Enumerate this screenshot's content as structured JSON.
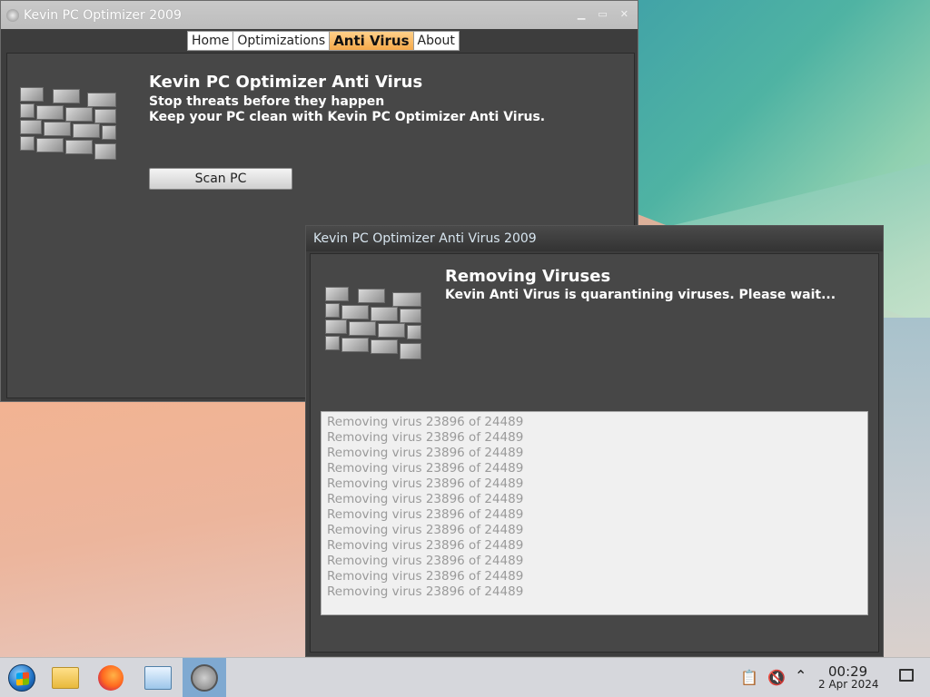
{
  "main_window": {
    "title": "Kevin PC Optimizer 2009",
    "tabs": [
      {
        "label": "Home",
        "active": false
      },
      {
        "label": "Optimizations",
        "active": false
      },
      {
        "label": "Anti Virus",
        "active": true
      },
      {
        "label": "About",
        "active": false
      }
    ],
    "heading": "Kevin PC Optimizer Anti Virus",
    "subheading_1": "Stop threats before they happen",
    "subheading_2": "Keep your PC clean with Kevin PC Optimizer Anti Virus.",
    "scan_button": "Scan PC",
    "icon": "brick-wall-icon"
  },
  "antivirus_window": {
    "title": "Kevin PC Optimizer Anti Virus 2009",
    "heading": "Removing Viruses",
    "subheading": "Kevin Anti Virus is quarantining viruses. Please wait...",
    "icon": "brick-wall-icon",
    "log": [
      "Removing virus 23896 of 24489",
      "Removing virus 23896 of 24489",
      "Removing virus 23896 of 24489",
      "Removing virus 23896 of 24489",
      "Removing virus 23896 of 24489",
      "Removing virus 23896 of 24489",
      "Removing virus 23896 of 24489",
      "Removing virus 23896 of 24489",
      "Removing virus 23896 of 24489",
      "Removing virus 23896 of 24489",
      "Removing virus 23896 of 24489",
      "Removing virus 23896 of 24489"
    ]
  },
  "taskbar": {
    "apps": [
      {
        "name": "start-menu-icon"
      },
      {
        "name": "file-manager-icon"
      },
      {
        "name": "firefox-icon"
      },
      {
        "name": "system-monitor-icon"
      },
      {
        "name": "kevin-optimizer-icon",
        "active": true
      }
    ],
    "tray": {
      "clipboard": "clipboard-icon",
      "volume": "volume-muted-icon",
      "expand": "chevron-up-icon"
    },
    "clock": {
      "time": "00:29",
      "date": "2 Apr 2024"
    }
  }
}
